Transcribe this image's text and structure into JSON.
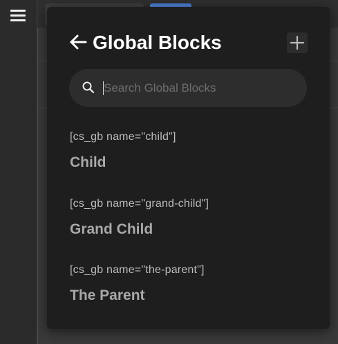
{
  "panel": {
    "title": "Global Blocks",
    "back_icon": "arrow-left-icon",
    "add_icon": "plus-icon"
  },
  "search": {
    "placeholder": "Search Global Blocks",
    "value": "",
    "icon": "search-icon"
  },
  "blocks": [
    {
      "shortcode": "[cs_gb name=\"child\"]",
      "name": "Child"
    },
    {
      "shortcode": "[cs_gb name=\"grand-child\"]",
      "name": "Grand Child"
    },
    {
      "shortcode": "[cs_gb name=\"the-parent\"]",
      "name": "The Parent"
    }
  ],
  "colors": {
    "panel_background": "#1e1e1e",
    "accent": "#4a7fd6",
    "title_text": "#ffffff",
    "muted_text": "#a9a9a9"
  },
  "sidebar": {
    "menu_icon": "hamburger-menu-icon"
  }
}
